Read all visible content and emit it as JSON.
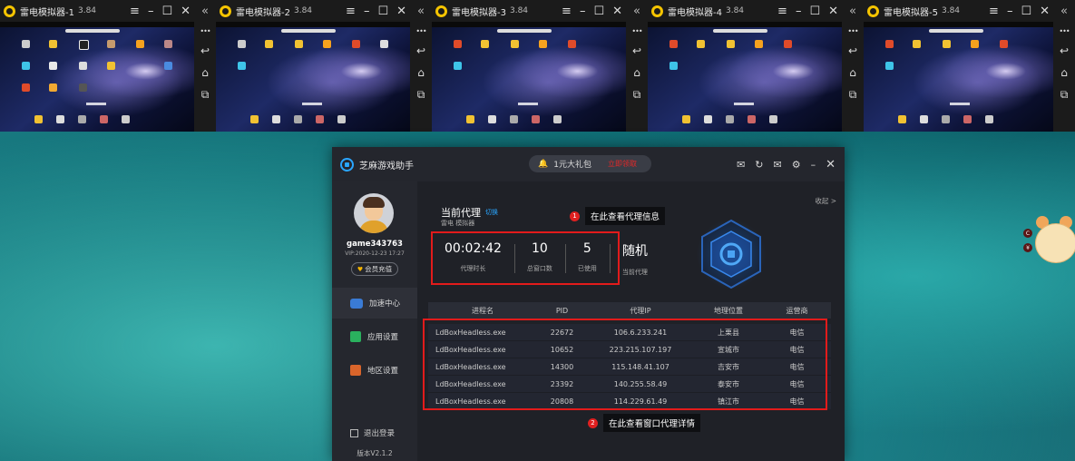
{
  "emulators": [
    {
      "name": "雷电模拟器-1",
      "version": "3.84"
    },
    {
      "name": "雷电模拟器-2",
      "version": "3.84"
    },
    {
      "name": "雷电模拟器-3",
      "version": "3.84"
    },
    {
      "name": "雷电模拟器-4",
      "version": "3.84"
    },
    {
      "name": "雷电模拟器-5",
      "version": "3.84"
    }
  ],
  "emu_controls": {
    "menu": "≡",
    "minimize": "–",
    "maximize": "☐",
    "close": "✕",
    "collapse": "«",
    "more": "•••",
    "back": "↩",
    "home": "⌂",
    "recent": "⧉"
  },
  "app": {
    "title": "芝麻游戏助手",
    "promo": {
      "text": "1元大礼包",
      "hot": "立即领取"
    },
    "window_icons": {
      "mail_alt": "✉",
      "refresh": "↻",
      "mail": "✉",
      "settings": "⚙",
      "minimize": "–",
      "close": "✕"
    }
  },
  "user": {
    "name": "game343763",
    "vip": "VIP:2020-12-23 17:27",
    "vip_button": "会员充值"
  },
  "nav": [
    {
      "label": "加速中心",
      "active": true,
      "icon": "gamepad-icon",
      "color": "#3a7bd5"
    },
    {
      "label": "应用设置",
      "active": false,
      "icon": "puzzle-icon",
      "color": "#2ab15e"
    },
    {
      "label": "地区设置",
      "active": false,
      "icon": "region-icon",
      "color": "#d9652b"
    }
  ],
  "logout": "退出登录",
  "version": "版本V2.1.2",
  "panel": {
    "collapse": "收起 >",
    "title": "当前代理",
    "switch": "切换",
    "sub": "雷电 模拟器"
  },
  "stats": [
    {
      "value": "00:02:42",
      "label": "代理时长"
    },
    {
      "value": "10",
      "label": "总窗口数"
    },
    {
      "value": "5",
      "label": "已使用"
    },
    {
      "value": "随机",
      "label": "当前代理"
    }
  ],
  "annotations": [
    {
      "num": "1",
      "text": "在此查看代理信息"
    },
    {
      "num": "2",
      "text": "在此查看窗口代理详情"
    }
  ],
  "table": {
    "headers": [
      "进程名",
      "PID",
      "代理IP",
      "地理位置",
      "运营商"
    ],
    "rows": [
      [
        "LdBoxHeadless.exe",
        "22672",
        "106.6.233.241",
        "上栗县",
        "电信"
      ],
      [
        "LdBoxHeadless.exe",
        "10652",
        "223.215.107.197",
        "宣城市",
        "电信"
      ],
      [
        "LdBoxHeadless.exe",
        "14300",
        "115.148.41.107",
        "吉安市",
        "电信"
      ],
      [
        "LdBoxHeadless.exe",
        "23392",
        "140.255.58.49",
        "泰安市",
        "电信"
      ],
      [
        "LdBoxHeadless.exe",
        "20808",
        "114.229.61.49",
        "镇江市",
        "电信"
      ]
    ]
  },
  "mascot": {
    "btn_top": "C",
    "btn_bottom": "¥"
  },
  "colors": {
    "accent": "#2aa6ff",
    "annotation_red": "#e21b1b",
    "gold": "#f5b400"
  }
}
